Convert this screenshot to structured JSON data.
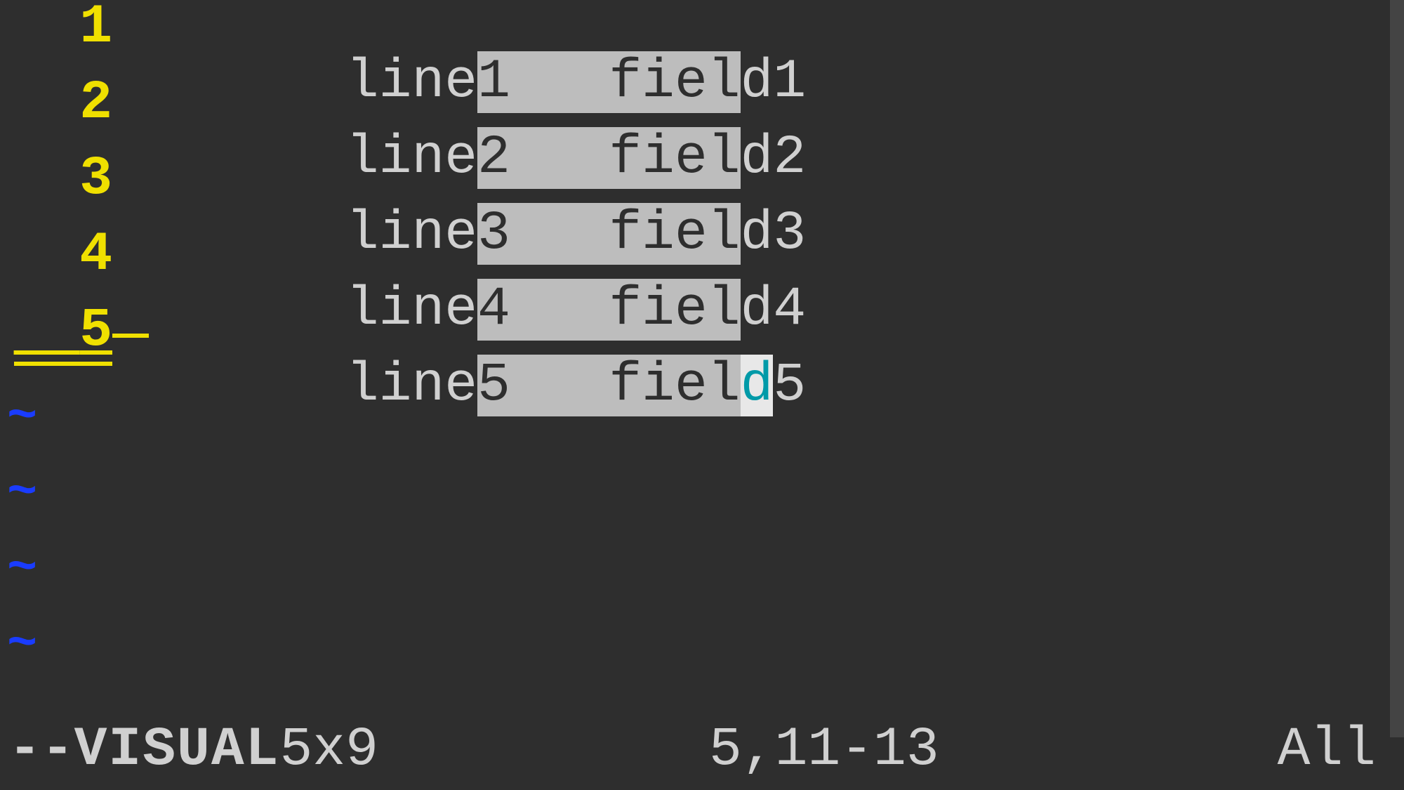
{
  "lines": [
    {
      "num": "1",
      "pre": "line",
      "sel": "1   fiel",
      "post": "d1",
      "cursor": ""
    },
    {
      "num": "2",
      "pre": "line",
      "sel": "2   fiel",
      "post": "d2",
      "cursor": ""
    },
    {
      "num": "3",
      "pre": "line",
      "sel": "3   fiel",
      "post": "d3",
      "cursor": ""
    },
    {
      "num": "4",
      "pre": "line",
      "sel": "4   fiel",
      "post": "d4",
      "cursor": ""
    },
    {
      "num": "5",
      "pre": "line",
      "sel": "5   fiel",
      "post": "5",
      "cursor": "d"
    }
  ],
  "tilde": "~",
  "status": {
    "mode_prefix": "-- ",
    "mode_name": "VISUAL",
    "mode_dim": "5x9",
    "position": "5,11-13",
    "scroll": "All"
  }
}
